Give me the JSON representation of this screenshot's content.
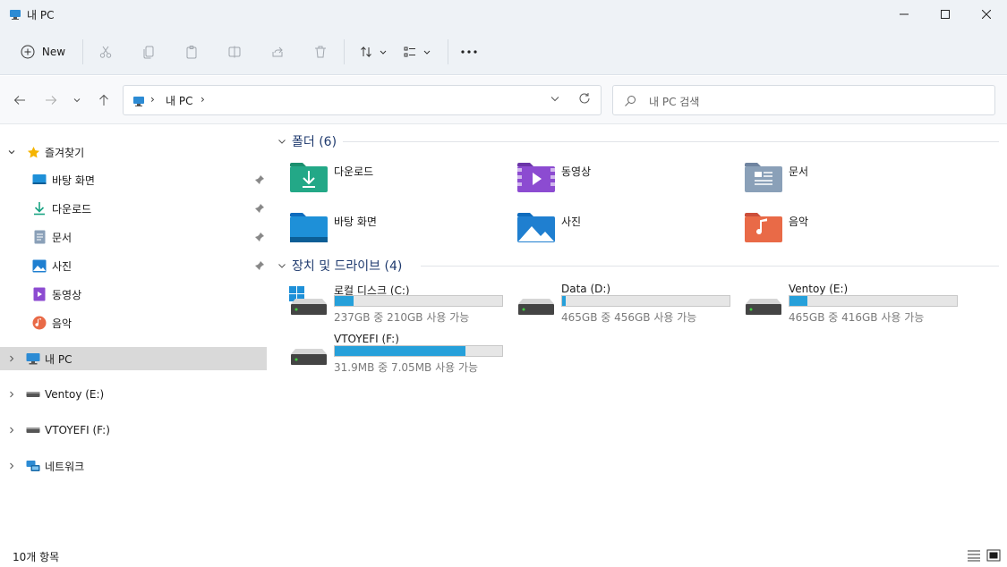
{
  "window": {
    "title": "내 PC",
    "minimize_label": "",
    "controls": [
      "minimize-icon",
      "maximize-icon",
      "close-icon"
    ]
  },
  "toolbar": {
    "new_label": "New",
    "buttons": [
      "cut-icon",
      "copy-icon",
      "paste-icon",
      "rename-icon",
      "share-icon",
      "delete-icon",
      "sort-icon",
      "view-icon",
      "more-icon"
    ]
  },
  "address": {
    "crumb": "내 PC",
    "search_placeholder": "내 PC 검색"
  },
  "sidebar": {
    "quick_access": "즐겨찾기",
    "items": [
      {
        "label": "바탕 화면",
        "icon": "desktop-icon",
        "pinned": true
      },
      {
        "label": "다운로드",
        "icon": "download-icon",
        "pinned": true
      },
      {
        "label": "문서",
        "icon": "document-icon",
        "pinned": true
      },
      {
        "label": "사진",
        "icon": "pictures-icon",
        "pinned": true
      },
      {
        "label": "동영상",
        "icon": "videos-icon",
        "pinned": false
      },
      {
        "label": "음악",
        "icon": "music-icon",
        "pinned": false
      }
    ],
    "this_pc": "내 PC",
    "ventoy": "Ventoy (E:)",
    "vtoyefi": "VTOYEFI (F:)",
    "network": "네트워크"
  },
  "folders": {
    "header": "폴더 (6)",
    "items": [
      {
        "name": "다운로드",
        "icon": "downloads-folder-icon"
      },
      {
        "name": "동영상",
        "icon": "videos-folder-icon"
      },
      {
        "name": "문서",
        "icon": "documents-folder-icon"
      },
      {
        "name": "바탕 화면",
        "icon": "desktop-folder-icon"
      },
      {
        "name": "사진",
        "icon": "pictures-folder-icon"
      },
      {
        "name": "음악",
        "icon": "music-folder-icon"
      }
    ]
  },
  "drives": {
    "header": "장치 및 드라이브 (4)",
    "items": [
      {
        "name": "로컬 디스크 (C:)",
        "space": "237GB 중 210GB 사용 가능",
        "used_fraction": 0.114,
        "icon": "system-drive-icon"
      },
      {
        "name": "Data (D:)",
        "space": "465GB 중 456GB 사용 가능",
        "used_fraction": 0.019,
        "icon": "drive-icon"
      },
      {
        "name": "Ventoy (E:)",
        "space": "465GB 중 416GB 사용 가능",
        "used_fraction": 0.105,
        "icon": "drive-icon"
      },
      {
        "name": "VTOYEFI (F:)",
        "space": "31.9MB 중 7.05MB 사용 가능",
        "used_fraction": 0.779,
        "icon": "drive-icon"
      }
    ]
  },
  "status": {
    "count": "10개 항목"
  },
  "colors": {
    "accent": "#26a0da",
    "chrome": "#eef2f6",
    "selected": "#d9d9d9"
  }
}
